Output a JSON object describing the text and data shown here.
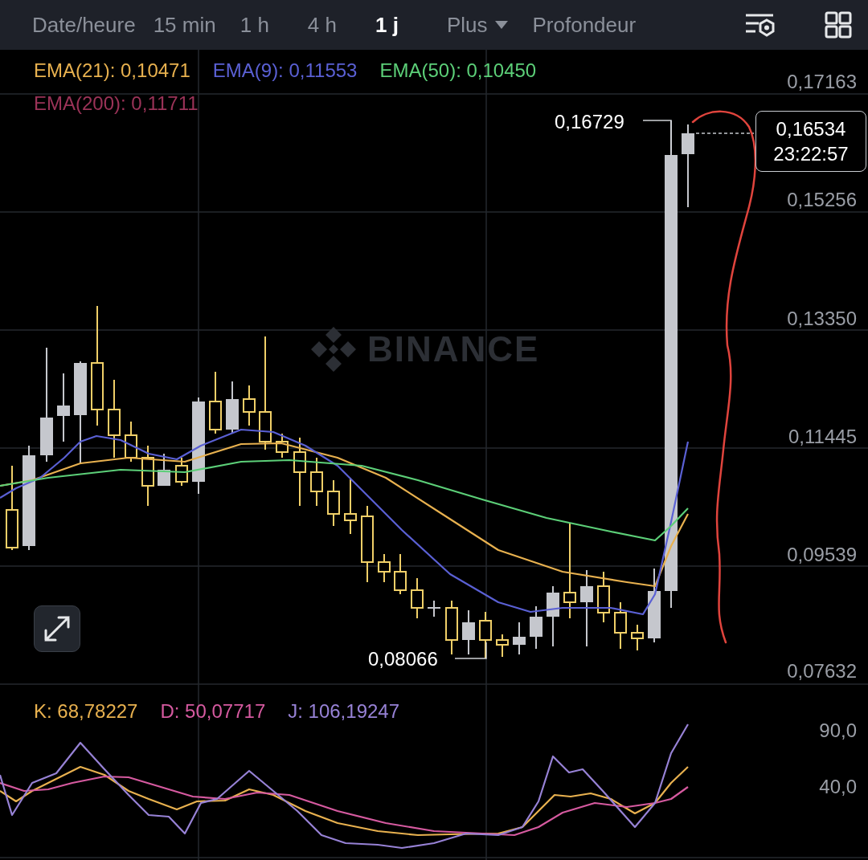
{
  "toolbar": {
    "tabs": [
      {
        "label": "Date/heure",
        "selected": false
      },
      {
        "label": "15 min",
        "selected": false
      },
      {
        "label": "1 h",
        "selected": false
      },
      {
        "label": "4 h",
        "selected": false
      },
      {
        "label": "1 j",
        "selected": true
      }
    ],
    "more_menu": {
      "label": "Plus"
    },
    "depth_tab": {
      "label": "Profondeur"
    }
  },
  "main_chart": {
    "indicators": [
      {
        "label": "EMA(21): 0,10471",
        "color": "#e8b14f"
      },
      {
        "label": "EMA(9): 0,11553",
        "color": "#5a60d4"
      },
      {
        "label": "EMA(50): 0,10450",
        "color": "#5ccf78"
      },
      {
        "label": "EMA(200): 0,11711",
        "color": "#9b3358"
      }
    ],
    "logo_text": "BINANCE",
    "price_axis": [
      "0,17163",
      "0,15256",
      "0,13350",
      "0,11445",
      "0,09539",
      "0,07632"
    ],
    "high_label": "0,16729",
    "low_label": "0,08066",
    "last_price": {
      "price": "0,16534",
      "countdown": "23:22:57"
    }
  },
  "kdj_panel": {
    "indicators": [
      {
        "label": "K: 68,78227",
        "color": "#e8b14f"
      },
      {
        "label": "D: 50,07717",
        "color": "#d65aa0"
      },
      {
        "label": "J: 106,19247",
        "color": "#9782d6"
      }
    ],
    "axis": [
      "90,0",
      "40,0"
    ]
  }
}
